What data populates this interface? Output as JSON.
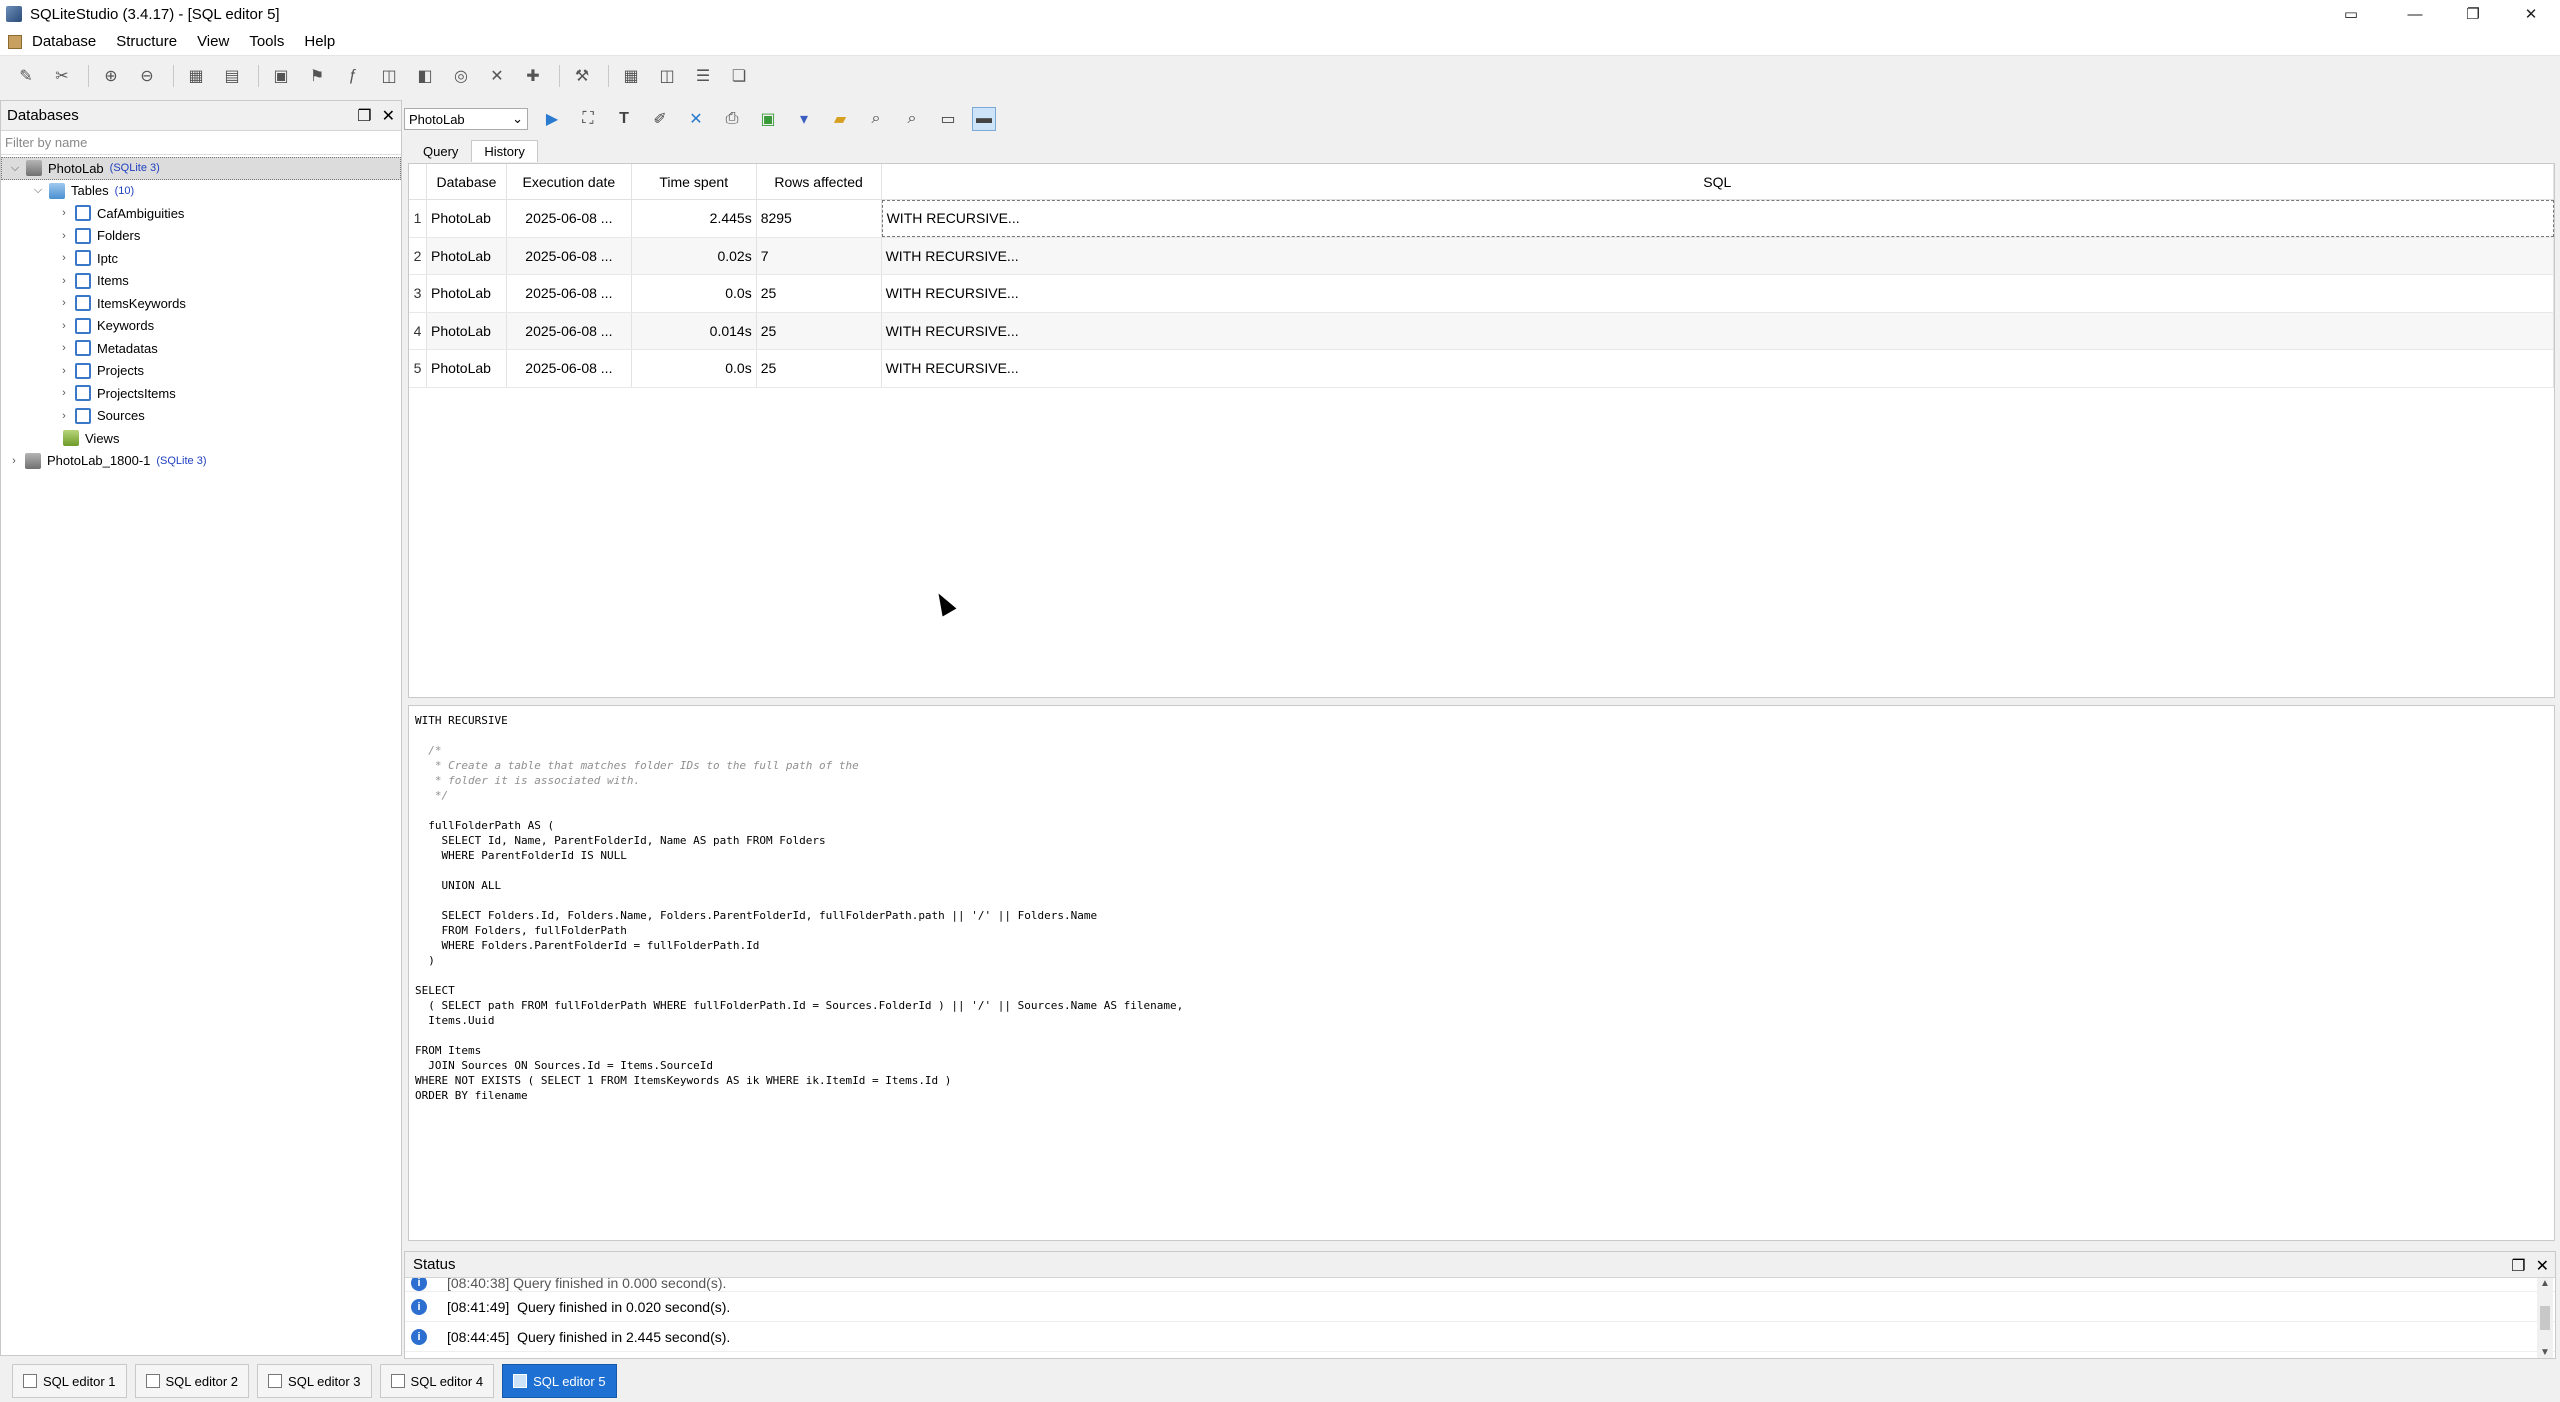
{
  "window": {
    "title": "SQLiteStudio (3.4.17) - [SQL editor 5]",
    "minimize": "—",
    "maximize": "❐",
    "close": "✕",
    "extra": "▭"
  },
  "menu": [
    "Database",
    "Structure",
    "View",
    "Tools",
    "Help"
  ],
  "db_panel": {
    "title": "Databases",
    "filter_placeholder": "Filter by name",
    "tree": {
      "db1": {
        "name": "PhotoLab",
        "tag": "(SQLite 3)"
      },
      "tables": {
        "name": "Tables",
        "count": "(10)"
      },
      "table_items": [
        "CafAmbiguities",
        "Folders",
        "Iptc",
        "Items",
        "ItemsKeywords",
        "Keywords",
        "Metadatas",
        "Projects",
        "ProjectsItems",
        "Sources"
      ],
      "views": "Views",
      "db2": {
        "name": "PhotoLab_1800-1",
        "tag": "(SQLite 3)"
      }
    }
  },
  "editor": {
    "db_select": "PhotoLab",
    "tabs": [
      "Query",
      "History"
    ],
    "grid": {
      "headers": [
        "Database",
        "Execution date",
        "Time spent",
        "Rows affected",
        "SQL"
      ],
      "rows": [
        {
          "n": "1",
          "db": "PhotoLab",
          "date": "2025-06-08 ...",
          "time": "2.445s",
          "rows": "8295",
          "sql": "WITH RECURSIVE..."
        },
        {
          "n": "2",
          "db": "PhotoLab",
          "date": "2025-06-08 ...",
          "time": "0.02s",
          "rows": "7",
          "sql": "WITH RECURSIVE..."
        },
        {
          "n": "3",
          "db": "PhotoLab",
          "date": "2025-06-08 ...",
          "time": "0.0s",
          "rows": "25",
          "sql": "WITH RECURSIVE..."
        },
        {
          "n": "4",
          "db": "PhotoLab",
          "date": "2025-06-08 ...",
          "time": "0.014s",
          "rows": "25",
          "sql": "WITH RECURSIVE..."
        },
        {
          "n": "5",
          "db": "PhotoLab",
          "date": "2025-06-08 ...",
          "time": "0.0s",
          "rows": "25",
          "sql": "WITH RECURSIVE..."
        }
      ]
    },
    "sql_lines": [
      {
        "t": "WITH RECURSIVE",
        "c": false
      },
      {
        "t": "",
        "c": false
      },
      {
        "t": "  /*",
        "c": true
      },
      {
        "t": "   * Create a table that matches folder IDs to the full path of the",
        "c": true
      },
      {
        "t": "   * folder it is associated with.",
        "c": true
      },
      {
        "t": "   */",
        "c": true
      },
      {
        "t": "",
        "c": false
      },
      {
        "t": "  fullFolderPath AS (",
        "c": false
      },
      {
        "t": "    SELECT Id, Name, ParentFolderId, Name AS path FROM Folders",
        "c": false
      },
      {
        "t": "    WHERE ParentFolderId IS NULL",
        "c": false
      },
      {
        "t": "",
        "c": false
      },
      {
        "t": "    UNION ALL",
        "c": false
      },
      {
        "t": "",
        "c": false
      },
      {
        "t": "    SELECT Folders.Id, Folders.Name, Folders.ParentFolderId, fullFolderPath.path || '/' || Folders.Name",
        "c": false
      },
      {
        "t": "    FROM Folders, fullFolderPath",
        "c": false
      },
      {
        "t": "    WHERE Folders.ParentFolderId = fullFolderPath.Id",
        "c": false
      },
      {
        "t": "  )",
        "c": false
      },
      {
        "t": "",
        "c": false
      },
      {
        "t": "SELECT",
        "c": false
      },
      {
        "t": "  ( SELECT path FROM fullFolderPath WHERE fullFolderPath.Id = Sources.FolderId ) || '/' || Sources.Name AS filename,",
        "c": false
      },
      {
        "t": "  Items.Uuid",
        "c": false
      },
      {
        "t": "",
        "c": false
      },
      {
        "t": "FROM Items",
        "c": false
      },
      {
        "t": "  JOIN Sources ON Sources.Id = Items.SourceId",
        "c": false
      },
      {
        "t": "WHERE NOT EXISTS ( SELECT 1 FROM ItemsKeywords AS ik WHERE ik.ItemId = Items.Id )",
        "c": false
      },
      {
        "t": "ORDER BY filename",
        "c": false
      }
    ]
  },
  "status": {
    "title": "Status",
    "rows": [
      {
        "time": "[08:40:38]",
        "msg": "Query finished in 0.000 second(s)."
      },
      {
        "time": "[08:41:49]",
        "msg": "Query finished in 0.020 second(s)."
      },
      {
        "time": "[08:44:45]",
        "msg": "Query finished in 2.445 second(s)."
      }
    ]
  },
  "task_tabs": [
    "SQL editor 1",
    "SQL editor 2",
    "SQL editor 3",
    "SQL editor 4",
    "SQL editor 5"
  ]
}
